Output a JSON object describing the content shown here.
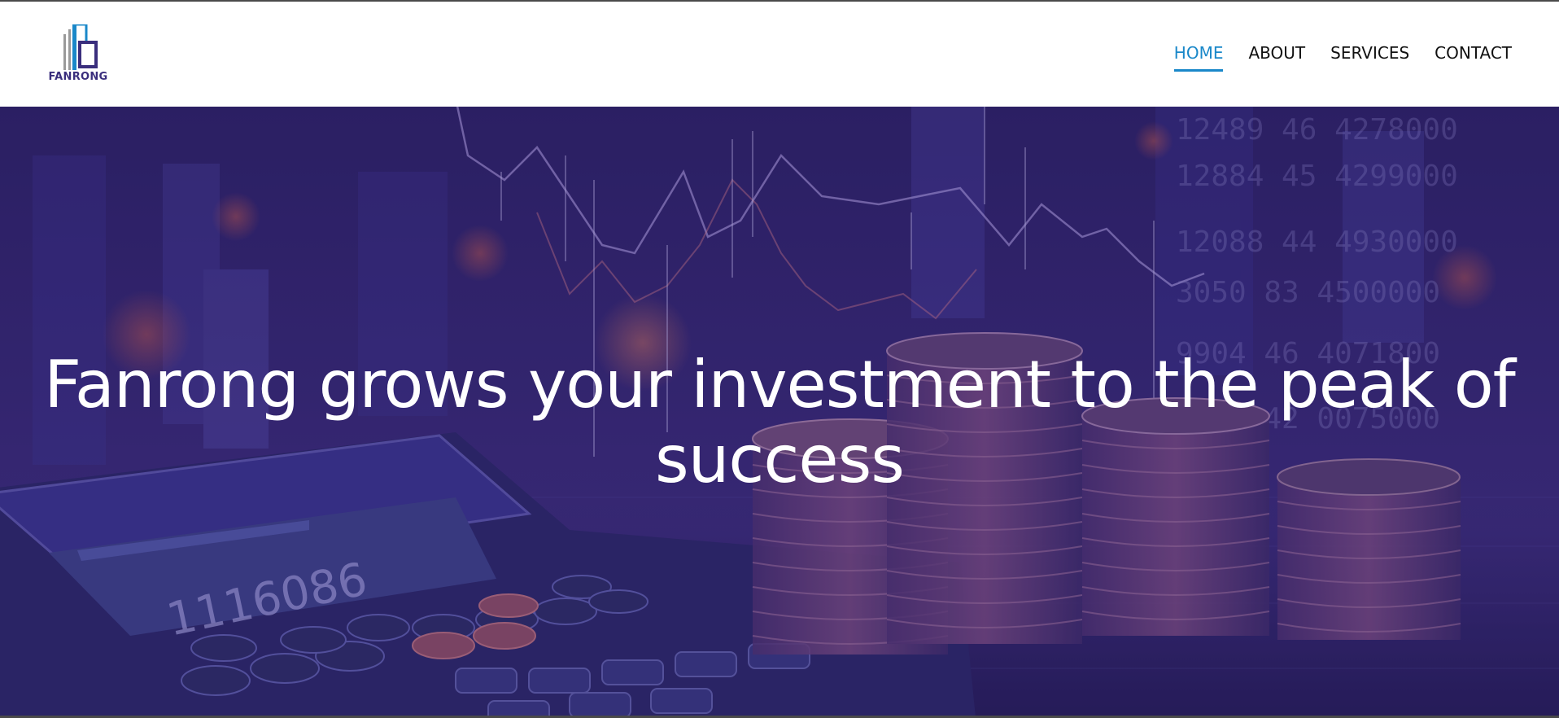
{
  "brand": {
    "name": "FANRONG",
    "color": "#3a2e7d",
    "accent": "#1a88c9"
  },
  "nav": {
    "items": [
      {
        "label": "HOME",
        "active": true
      },
      {
        "label": "ABOUT",
        "active": false
      },
      {
        "label": "SERVICES",
        "active": false
      },
      {
        "label": "CONTACT",
        "active": false
      }
    ]
  },
  "hero": {
    "headline": "Fanrong grows your investment to the peak of success",
    "overlay_color": "#2b1f63",
    "calculator_display": "1116086",
    "ticker_rows": [
      "12489 46 4278000",
      "12884 45 4299000",
      "12088 44 4930000",
      "3050 83 4500000",
      "9904 46 4071800",
      "5180 42 0075000"
    ]
  }
}
